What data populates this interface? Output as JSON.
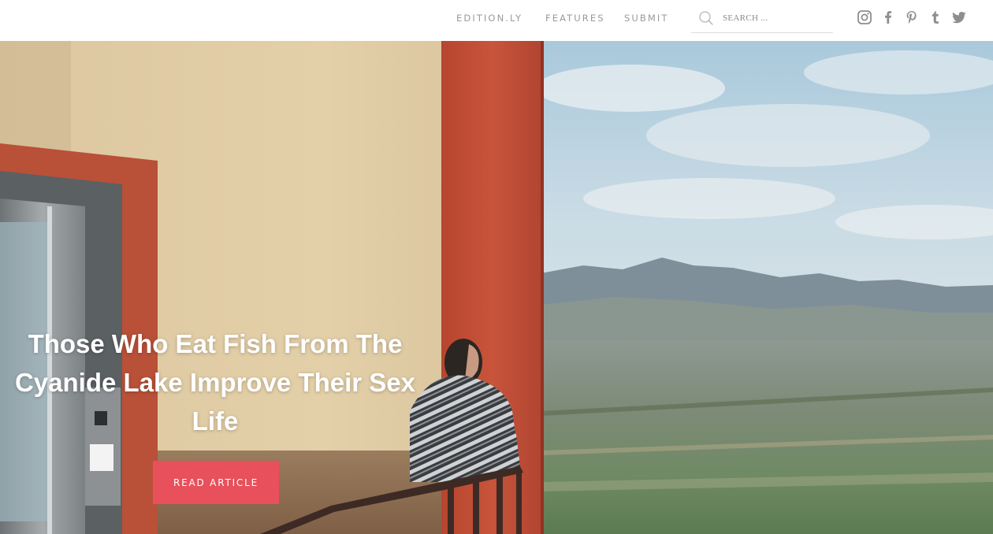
{
  "header": {
    "nav": [
      {
        "label": "EDITION.LY"
      },
      {
        "label": "FEATURES"
      },
      {
        "label": "SUBMIT"
      }
    ],
    "search": {
      "placeholder": "SEARCH ..."
    },
    "social_icons": [
      "instagram-icon",
      "facebook-icon",
      "pinterest-icon",
      "tumblr-icon",
      "twitter-icon"
    ],
    "icon_color": "#8e8e8e"
  },
  "hero": {
    "title": "Those Who Eat Fish From The Cyanide Lake Improve Their Sex Life",
    "cta_label": "READ ARTICLE",
    "cta_color": "#e8505b"
  }
}
